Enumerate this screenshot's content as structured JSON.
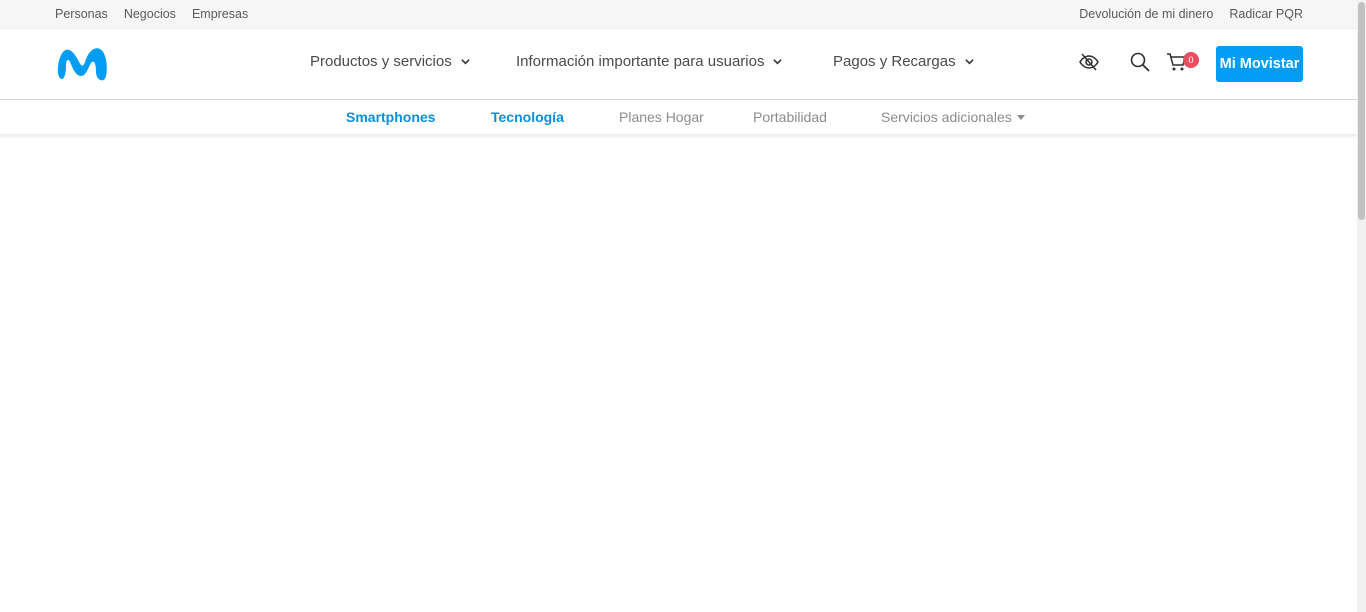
{
  "topbar": {
    "left_links": [
      "Personas",
      "Negocios",
      "Empresas"
    ],
    "right_links": [
      "Devolución de mi dinero",
      "Radicar PQR"
    ]
  },
  "header": {
    "logo_icon": "movistar-m-logo",
    "nav": [
      {
        "label": "Productos y servicios",
        "icon": "chevron-down-icon"
      },
      {
        "label": "Información importante para usuarios",
        "icon": "chevron-down-icon"
      },
      {
        "label": "Pagos y Recargas",
        "icon": "chevron-down-icon"
      }
    ],
    "icons": [
      "eye-slash-icon",
      "search-icon",
      "cart-icon"
    ],
    "cart_count": "0",
    "account_button": "Mi Movistar"
  },
  "subnav": {
    "items": [
      {
        "label": "Smartphones",
        "active": true
      },
      {
        "label": "Tecnología",
        "active": true
      },
      {
        "label": "Planes Hogar",
        "active": false
      },
      {
        "label": "Portabilidad",
        "active": false
      },
      {
        "label": "Servicios adicionales",
        "active": false,
        "dropdown": true
      }
    ]
  },
  "colors": {
    "brand_blue": "#019df4",
    "active_link": "#0b8fd8",
    "badge_red": "#ec4d5f",
    "topbar_bg": "#f6f6f6"
  }
}
